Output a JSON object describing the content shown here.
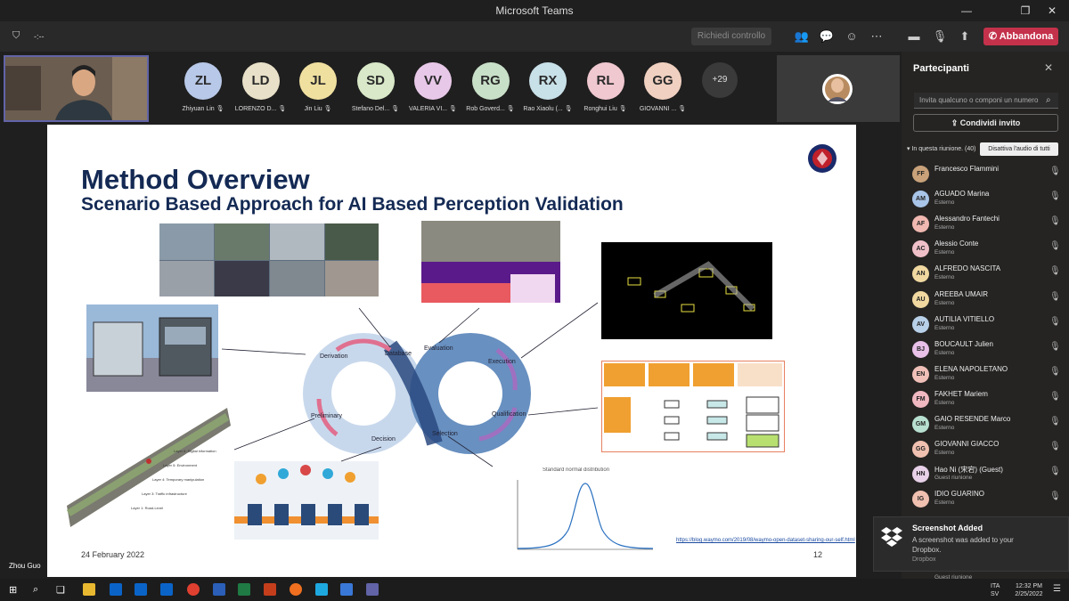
{
  "window": {
    "title": "Microsoft Teams",
    "minimize": "—",
    "maximize": "❐",
    "close": "✕"
  },
  "toolbar": {
    "timer": "-:--",
    "request_control": "Richiedi controllo",
    "leave": "Abbandona"
  },
  "participants_strip": [
    {
      "initials": "ZL",
      "name": "Zhiyuan Lin",
      "color": "#b8c8e8"
    },
    {
      "initials": "LD",
      "name": "LORENZO D...",
      "color": "#e8e0c8"
    },
    {
      "initials": "JL",
      "name": "Jin Liu",
      "color": "#f0e0a0"
    },
    {
      "initials": "SD",
      "name": "Stefano Del...",
      "color": "#d8e8c8"
    },
    {
      "initials": "VV",
      "name": "VALERIA VI...",
      "color": "#e8c8e8"
    },
    {
      "initials": "RG",
      "name": "Rob Goverd...",
      "color": "#c8e0c8"
    },
    {
      "initials": "RX",
      "name": "Rao Xiaolu (...",
      "color": "#c8e0e8"
    },
    {
      "initials": "RL",
      "name": "Ronghui Liu",
      "color": "#f0c8d0"
    },
    {
      "initials": "GG",
      "name": "GIOVANNI ...",
      "color": "#f0d0c0"
    }
  ],
  "more_count": "+29",
  "slide": {
    "title": "Method Overview",
    "subtitle": "Scenario Based Approach for AI Based Perception Validation",
    "date": "24 February 2022",
    "page": "12",
    "url": "https://blog.waymo.com/2019/08/waymo-open-dataset-sharing-our-self.html",
    "loop_labels": {
      "derivation": "Derivation",
      "database": "Database",
      "evaluation": "Evaluation",
      "execution": "Execution",
      "preliminary": "Preliminary",
      "decision": "Decision",
      "selection": "Selection",
      "qualification": "Qualification"
    },
    "chart_title": "Standard normal distribution",
    "table_headers": [
      "Evaluation of impact potential to development artefacts",
      "Evaluation of measures regarding impact detection / mitigation",
      "Classification of tool into confidence classes",
      "Qualification according to ISO 26262-8"
    ],
    "tcl_labels": [
      "TD3",
      "TD2",
      "TD1",
      "TCL3",
      "TCL2",
      "TCL1"
    ]
  },
  "speaker": "Zhou Guo",
  "panel": {
    "title": "Partecipanti",
    "invite_placeholder": "Invita qualcuno o componi un numero",
    "share_invite": "Condividi invito",
    "in_meeting": "In questa riunione. (40)",
    "mute_all": "Disattiva l'audio di tutti",
    "people": [
      {
        "initials": "FF",
        "name": "Francesco Flammini",
        "sub": "",
        "color": "#c9a27a"
      },
      {
        "initials": "AM",
        "name": "AGUADO Marina",
        "sub": "Esterno",
        "color": "#a8c4e8"
      },
      {
        "initials": "AF",
        "name": "Alessandro Fantechi",
        "sub": "Esterno",
        "color": "#f0b8b0"
      },
      {
        "initials": "AC",
        "name": "Alessio Conte",
        "sub": "Esterno",
        "color": "#f0c0c8"
      },
      {
        "initials": "AN",
        "name": "ALFREDO NASCITA",
        "sub": "Esterno",
        "color": "#f0d8a0"
      },
      {
        "initials": "AU",
        "name": "AREEBA UMAIR",
        "sub": "Esterno",
        "color": "#f0d8a0"
      },
      {
        "initials": "AV",
        "name": "AUTILIA VITIELLO",
        "sub": "Esterno",
        "color": "#b8d0e8"
      },
      {
        "initials": "BJ",
        "name": "BOUCAULT Julien",
        "sub": "Esterno",
        "color": "#e8c0e8"
      },
      {
        "initials": "EN",
        "name": "ELENA NAPOLETANO",
        "sub": "Esterno",
        "color": "#f0c0b8"
      },
      {
        "initials": "FM",
        "name": "FAKHET Mariem",
        "sub": "Esterno",
        "color": "#f0b8c0"
      },
      {
        "initials": "GM",
        "name": "GAIO RESENDE Marco",
        "sub": "Esterno",
        "color": "#b8e0d0"
      },
      {
        "initials": "GG",
        "name": "GIOVANNI GIACCO",
        "sub": "Esterno",
        "color": "#f0c0b0"
      },
      {
        "initials": "HN",
        "name": "Hao Ni (宋宕) (Guest)",
        "sub": "Guest riunione",
        "color": "#e8d0e8"
      },
      {
        "initials": "IG",
        "name": "IDIO GUARINO",
        "sub": "Esterno",
        "color": "#f0c0b0"
      }
    ],
    "partial_row_sub": "Guest riunione"
  },
  "toast": {
    "title": "Screenshot Added",
    "body": "A screenshot was added to your Dropbox.",
    "source": "Dropbox"
  },
  "taskbar": {
    "lang": "ITA",
    "lang2": "SV",
    "time": "12:32 PM",
    "date": "2/25/2022"
  }
}
